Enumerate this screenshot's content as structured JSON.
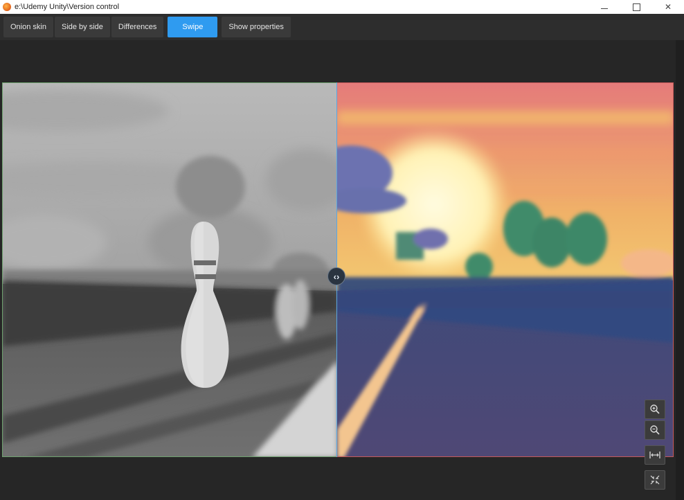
{
  "window": {
    "title": "e:\\Udemy Unity\\Version control",
    "minimize_icon": "minimize-icon",
    "maximize_icon": "maximize-icon",
    "close_icon": "close-icon"
  },
  "toolbar": {
    "tabs": [
      {
        "label": "Onion skin",
        "active": false
      },
      {
        "label": "Side by side",
        "active": false
      },
      {
        "label": "Differences",
        "active": false
      },
      {
        "label": "Swipe",
        "active": true
      },
      {
        "label": "Show properties",
        "active": false
      }
    ]
  },
  "viewer": {
    "mode": "Swipe",
    "left_image": "grayscale bowling lane render",
    "right_image": "sunset road render",
    "swipe_position": 0.5,
    "left_border_color": "#6fa36f",
    "right_border_color": "#c65a5a",
    "divider_color": "#5aa6e0"
  },
  "controls": {
    "zoom_in_icon": "zoom-in-icon",
    "zoom_out_icon": "zoom-out-icon",
    "fit_width_icon": "fit-width-icon",
    "fit_window_icon": "collapse-icon"
  },
  "colors": {
    "accent": "#2f9bf0",
    "toolbar_bg": "#2d2d2d",
    "tab_bg": "#3a3a3a",
    "viewport_bg": "#262626"
  }
}
